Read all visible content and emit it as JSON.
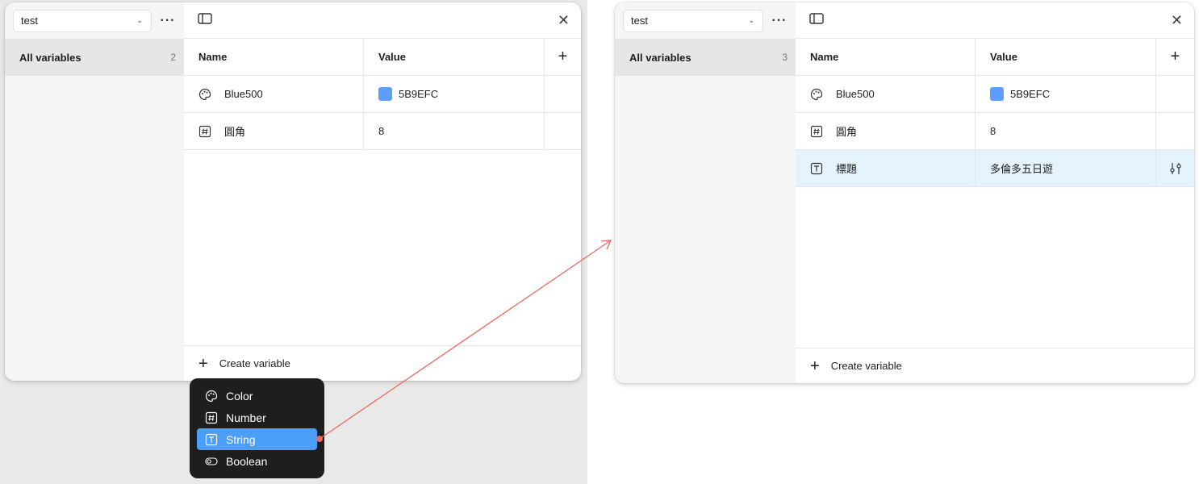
{
  "left": {
    "collection": "test",
    "sidebar": {
      "label": "All variables",
      "count": "2"
    },
    "headers": {
      "name": "Name",
      "value": "Value"
    },
    "rows": [
      {
        "name": "Blue500",
        "value": "5B9EFC",
        "icon": "palette-icon",
        "swatch": "#5b9efc"
      },
      {
        "name": "圓角",
        "value": "8",
        "icon": "number-icon"
      }
    ],
    "create": "Create variable"
  },
  "menu": {
    "items": [
      {
        "label": "Color",
        "icon": "palette-icon"
      },
      {
        "label": "Number",
        "icon": "number-icon"
      },
      {
        "label": "String",
        "icon": "text-icon",
        "active": true
      },
      {
        "label": "Boolean",
        "icon": "toggle-icon"
      }
    ],
    "active_color": "#4c9ff8"
  },
  "right": {
    "collection": "test",
    "sidebar": {
      "label": "All variables",
      "count": "3"
    },
    "headers": {
      "name": "Name",
      "value": "Value"
    },
    "rows": [
      {
        "name": "Blue500",
        "value": "5B9EFC",
        "icon": "palette-icon",
        "swatch": "#5b9efc"
      },
      {
        "name": "圓角",
        "value": "8",
        "icon": "number-icon"
      },
      {
        "name": "標題",
        "value": "多倫多五日遊",
        "icon": "text-icon",
        "selected": true
      }
    ],
    "create": "Create variable"
  },
  "arrow_color": "#e8675f"
}
